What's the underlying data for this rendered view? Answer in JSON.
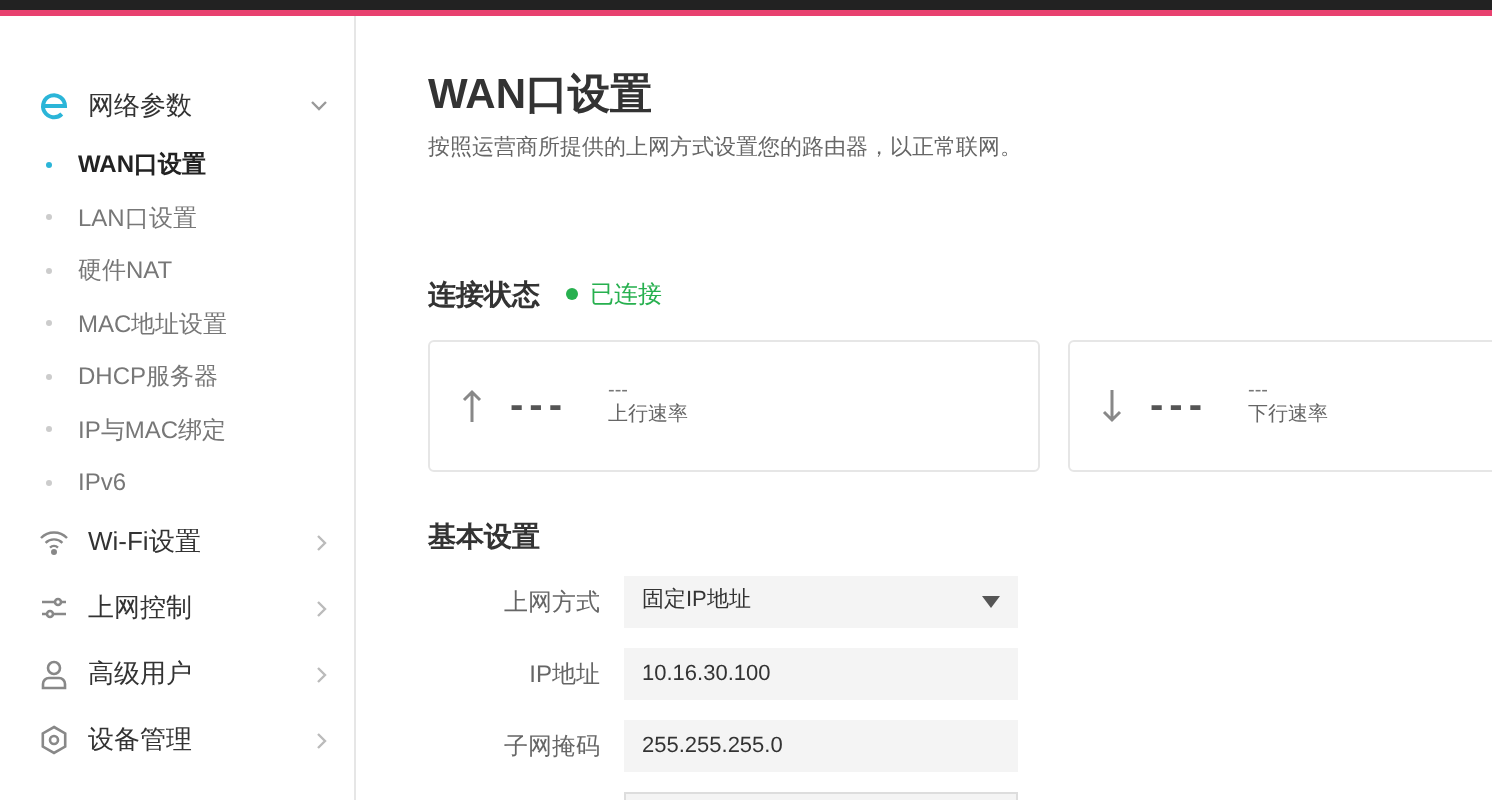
{
  "sidebar": {
    "groups": [
      {
        "label": "网络参数",
        "expanded": true,
        "children": [
          {
            "label": "WAN口设置",
            "selected": true
          },
          {
            "label": "LAN口设置",
            "selected": false
          },
          {
            "label": "硬件NAT",
            "selected": false
          },
          {
            "label": "MAC地址设置",
            "selected": false
          },
          {
            "label": "DHCP服务器",
            "selected": false
          },
          {
            "label": "IP与MAC绑定",
            "selected": false
          },
          {
            "label": "IPv6",
            "selected": false
          }
        ]
      },
      {
        "label": "Wi-Fi设置",
        "expanded": false
      },
      {
        "label": "上网控制",
        "expanded": false
      },
      {
        "label": "高级用户",
        "expanded": false
      },
      {
        "label": "设备管理",
        "expanded": false
      }
    ]
  },
  "page": {
    "title": "WAN口设置",
    "description": "按照运营商所提供的上网方式设置您的路由器，以正常联网。"
  },
  "connection": {
    "heading": "连接状态",
    "status": "已连接",
    "connected": true,
    "cards": [
      {
        "kind": "up",
        "value": "---",
        "unit": "---",
        "label": "上行速率"
      },
      {
        "kind": "down",
        "value": "---",
        "unit": "---",
        "label": "下行速率"
      }
    ]
  },
  "basic": {
    "heading": "基本设置",
    "fields": [
      {
        "kind": "select",
        "label": "上网方式",
        "value": "固定IP地址"
      },
      {
        "kind": "text",
        "label": "IP地址",
        "value": "10.16.30.100"
      },
      {
        "kind": "text",
        "label": "子网掩码",
        "value": "255.255.255.0"
      }
    ]
  }
}
